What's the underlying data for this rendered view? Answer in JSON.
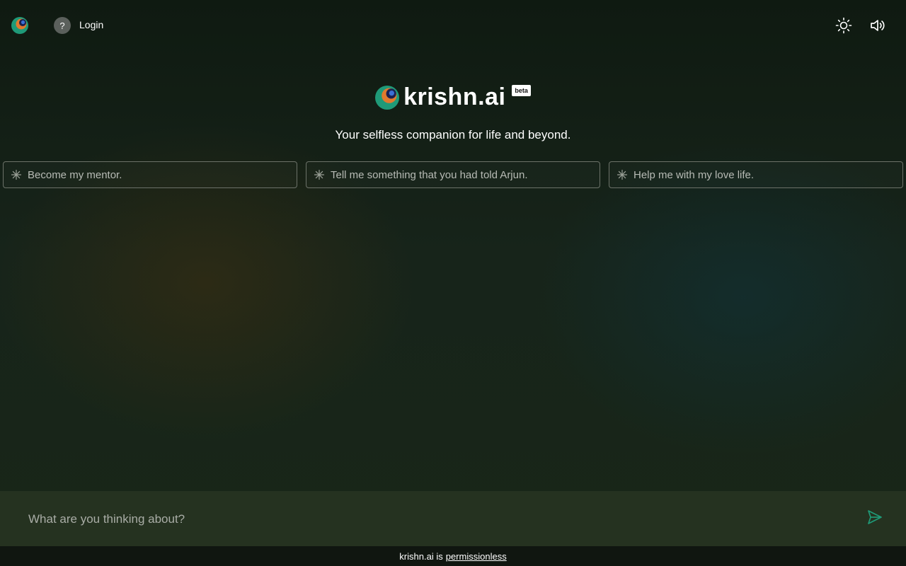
{
  "header": {
    "help_label": "?",
    "login_label": "Login",
    "icons": [
      "logo-icon",
      "help-icon",
      "sun-icon",
      "speaker-icon"
    ]
  },
  "brand": {
    "name": "krishn.ai",
    "badge": "beta",
    "tagline": "Your selfless companion for life and beyond."
  },
  "suggestions": [
    {
      "label": "Become my mentor."
    },
    {
      "label": "Tell me something that you had told Arjun."
    },
    {
      "label": "Help me with my love life."
    }
  ],
  "composer": {
    "placeholder": "What are you thinking about?",
    "value": ""
  },
  "footer": {
    "prefix": "krishn.ai is",
    "link": "permissionless"
  },
  "colors": {
    "accent": "#1f9a78",
    "logo_orange": "#e07a2e",
    "logo_navy": "#1a2050"
  }
}
